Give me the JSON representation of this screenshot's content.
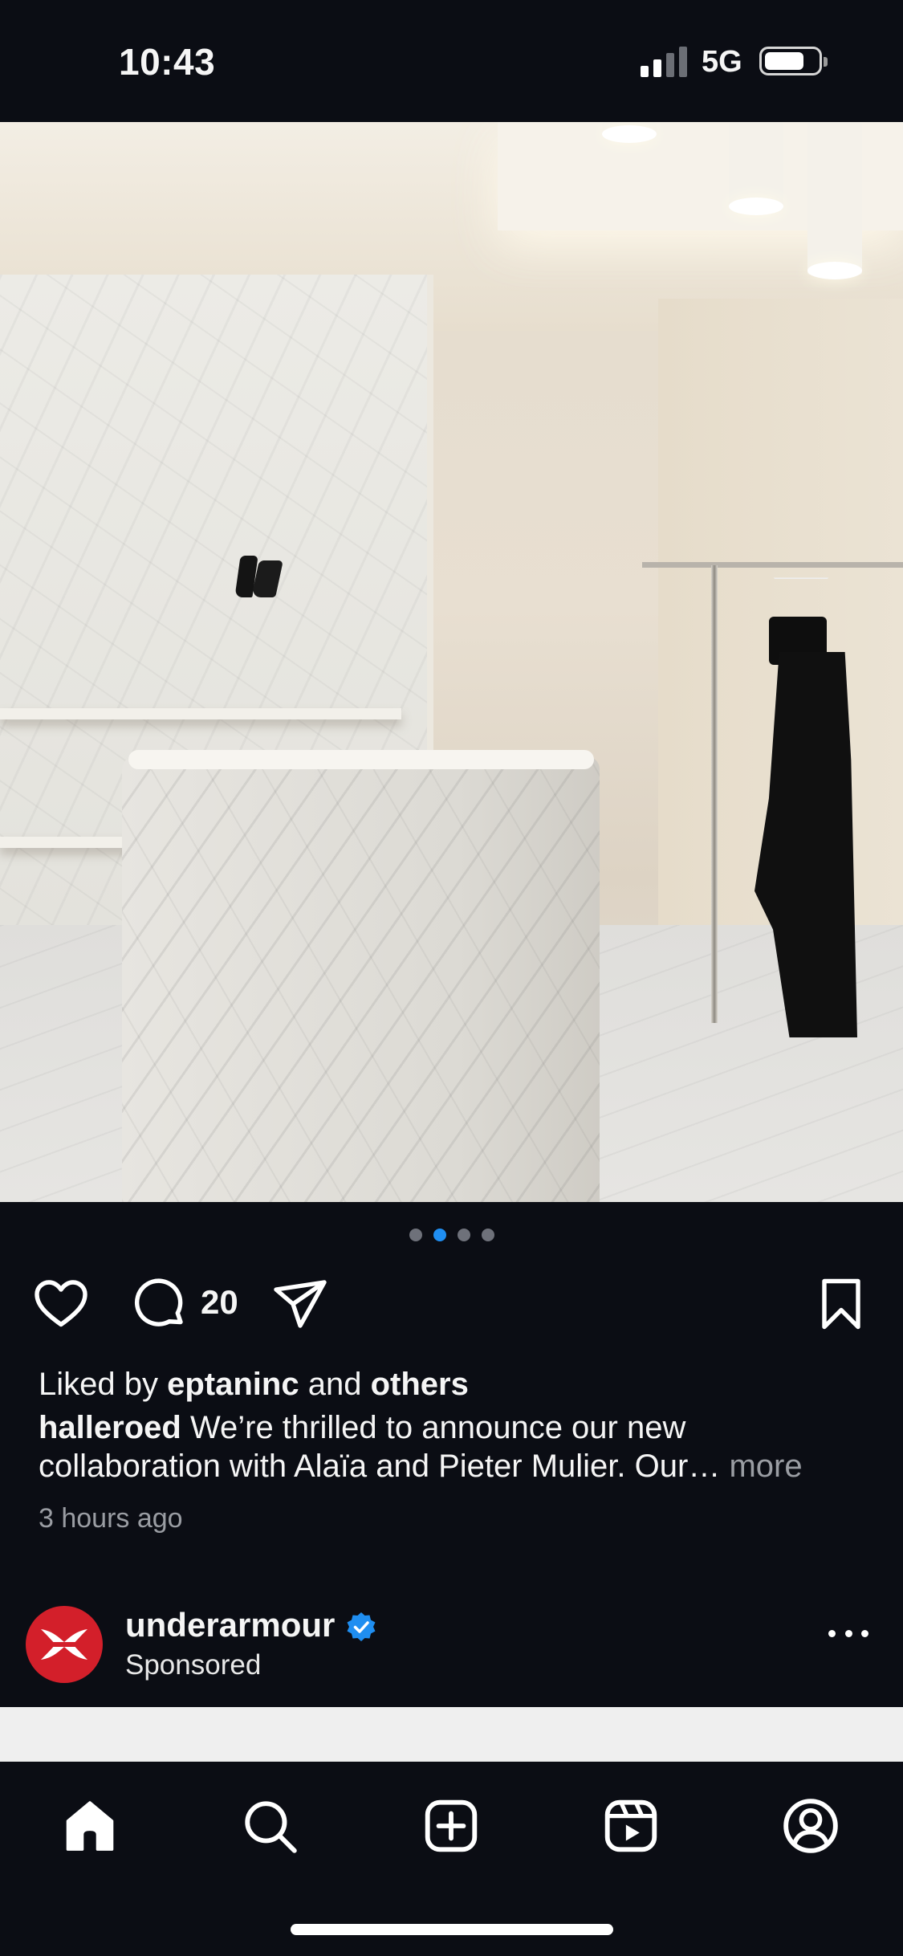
{
  "status_bar": {
    "time": "10:43",
    "network": "5G",
    "signal_bars_active": 2,
    "signal_bars_total": 4,
    "battery_level": 0.75
  },
  "post": {
    "image_semantic": "marble-boutique-interior",
    "carousel": {
      "total_slides": 4,
      "active_index": 1,
      "active_color": "#1f8ef1"
    },
    "actions": {
      "like_icon": "heart-icon",
      "comment_icon": "comment-icon",
      "comment_count": "20",
      "share_icon": "send-icon",
      "save_icon": "bookmark-icon"
    },
    "likes": {
      "prefix": "Liked by ",
      "user": "eptaninc",
      "conjunction": " and ",
      "others": "others"
    },
    "caption": {
      "author": "halleroed",
      "text": " We’re thrilled to announce our new collaboration with Alaïa and Pieter Mulier. Our…",
      "more_label": " more"
    },
    "time_ago": "3 hours ago"
  },
  "next_post": {
    "account": "underarmour",
    "verified": true,
    "verified_color": "#1f8ef1",
    "subtitle": "Sponsored",
    "avatar_color": "#d31f2a",
    "avatar_icon": "under-armour-logo",
    "menu_icon": "more-horizontal-icon"
  },
  "tab_bar": {
    "items": [
      {
        "icon": "home-icon",
        "active": true
      },
      {
        "icon": "search-icon",
        "active": false
      },
      {
        "icon": "create-icon",
        "active": false
      },
      {
        "icon": "reels-icon",
        "active": false
      },
      {
        "icon": "profile-icon",
        "active": false
      }
    ]
  }
}
